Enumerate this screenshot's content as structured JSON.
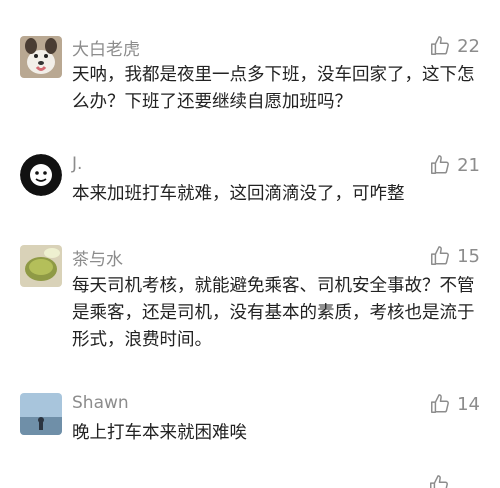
{
  "comments": [
    {
      "user": "大白老虎",
      "likes": "22",
      "text": "天呐，我都是夜里一点多下班，没车回家了，这下怎么办？下班了还要继续自愿加班吗？"
    },
    {
      "user": "J.",
      "likes": "21",
      "text": "本来加班打车就难，这回滴滴没了，可咋整"
    },
    {
      "user": "茶与水",
      "likes": "15",
      "text": "每天司机考核，就能避免乘客、司机安全事故？不管是乘客，还是司机，没有基本的素质，考核也是流于形式，浪费时间。"
    },
    {
      "user": "Shawn",
      "likes": "14",
      "text": "晚上打车本来就困难唉"
    }
  ],
  "colors": {
    "meta": "#8c8c8c",
    "text": "#222222",
    "background": "#ffffff"
  }
}
